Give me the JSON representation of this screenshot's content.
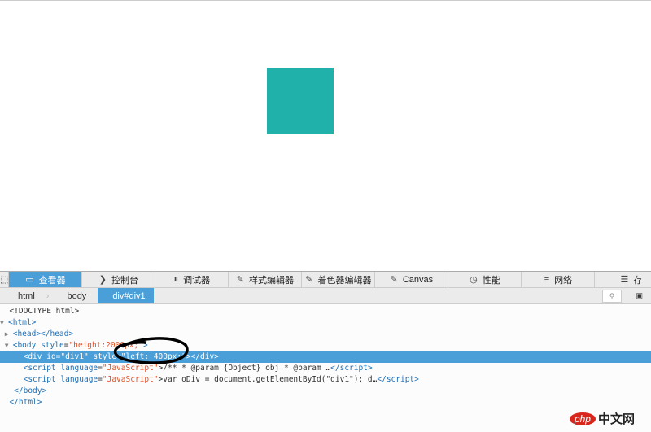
{
  "page": {
    "box_color": "#20b2aa"
  },
  "toolbar": {
    "tabs": [
      {
        "label": "查看器",
        "icon": "inspector-icon",
        "glyph": "▭"
      },
      {
        "label": "控制台",
        "icon": "console-icon",
        "glyph": "❯"
      },
      {
        "label": "调试器",
        "icon": "debugger-icon",
        "glyph": "⏸"
      },
      {
        "label": "样式编辑器",
        "icon": "style-editor-icon",
        "glyph": "✎"
      },
      {
        "label": "着色器编辑器",
        "icon": "shader-editor-icon",
        "glyph": "✎"
      },
      {
        "label": "Canvas",
        "icon": "canvas-icon",
        "glyph": "✎"
      },
      {
        "label": "性能",
        "icon": "performance-icon",
        "glyph": "◷"
      },
      {
        "label": "网络",
        "icon": "network-icon",
        "glyph": "≡"
      },
      {
        "label": "存",
        "icon": "storage-icon",
        "glyph": "☰"
      }
    ]
  },
  "breadcrumbs": [
    "html",
    "body",
    "div#div1"
  ],
  "code": {
    "l1": "<!DOCTYPE html>",
    "html_open": "<html>",
    "head": "<head></head>",
    "body_open": "<body",
    "style_attr": "style",
    "body_style": "\"height:2000px;\"",
    "div_open": "<div",
    "div_id": "id=\"div1\"",
    "div_style": "style=\"left: 400px;\"",
    "div_close": "></div>",
    "script_open": "<script",
    "lang_attr": "language",
    "lang_val": "\"JavaScript\"",
    "script1_body": "/** * @param {Object} obj * @param …",
    "script2_body": "var oDiv = document.getElementById(\"div1\"); d…",
    "script_close": "</script>",
    "body_close": "</body>",
    "html_close": "</html>"
  },
  "watermark": {
    "php": "php",
    "cn": "中文网"
  }
}
